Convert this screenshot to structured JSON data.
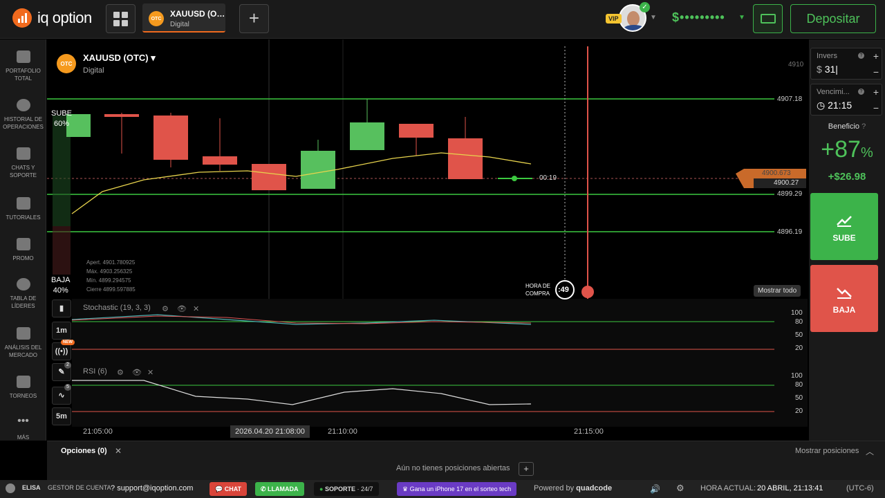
{
  "app": {
    "brand": "iq option"
  },
  "topbar": {
    "asset_tab_name": "XAUUSD (O…",
    "asset_tab_type": "Digital",
    "otc_badge": "OTC",
    "vip_badge": "VIP",
    "balance": "$•••••••••",
    "deposit_label": "Depositar"
  },
  "sidebar": {
    "items": [
      {
        "label": "PORTAFOLIO TOTAL",
        "icon": "briefcase-icon"
      },
      {
        "label": "HISTORIAL DE OPERACIONES",
        "icon": "clock-icon"
      },
      {
        "label": "CHATS Y SOPORTE",
        "icon": "chat-icon"
      },
      {
        "label": "TUTORIALES",
        "icon": "graduation-cap-icon"
      },
      {
        "label": "PROMO",
        "icon": "megaphone-icon"
      },
      {
        "label": "TABLA DE LÍDERES",
        "icon": "medal-icon"
      },
      {
        "label": "ANÁLISIS DEL MERCADO",
        "icon": "bar-chart-icon"
      },
      {
        "label": "TORNEOS",
        "icon": "trophy-icon"
      },
      {
        "label": "MÁS",
        "icon": "more-dots-icon"
      }
    ]
  },
  "chart_header": {
    "asset": "XAUUSD (OTC)",
    "type": "Digital",
    "sube_label": "SUBE",
    "sube_pct": "60%",
    "baja_label": "BAJA",
    "baja_pct": "40%",
    "stats": [
      "Apert.  4901.780925",
      "Máx.   4903.256325",
      "Mín.    4899.294575",
      "Cierre  4899.597885"
    ],
    "countdown": "00:19",
    "buy_time_label_1": "HORA DE",
    "buy_time_label_2": "COMPRA",
    "buy_timer": ":49",
    "show_all": "Mostrar todo",
    "current_price": "4900.27",
    "price_marker": "4900.673"
  },
  "price_levels": [
    "4910",
    "4907.18",
    "4899.29",
    "4896.19"
  ],
  "indicators": {
    "stochastic_label": "Stochastic (19, 3, 3)",
    "stoch_ticks": [
      "100",
      "80",
      "50",
      "20"
    ],
    "rsi_label": "RSI (6)",
    "rsi_ticks": [
      "100",
      "80",
      "50",
      "20"
    ]
  },
  "toolbar_mini": {
    "timeframe_1": "1m",
    "timeframe_2": "5m",
    "new_badge": "NEW",
    "draw_count": "2",
    "ind_count": "5"
  },
  "time_axis": [
    "21:05:00",
    "2026.04.20 21:08:00",
    "21:10:00",
    "21:15:00"
  ],
  "trade_panel": {
    "amount_label": "Invers",
    "currency": "$",
    "amount_value": "31",
    "expiry_label": "Vencimi...",
    "expiry_value": "21:15",
    "profit_label": "Beneficio",
    "profit_pct": "+87",
    "profit_pct_sign": "%",
    "profit_amount": "+$26.98",
    "up_label": "SUBE",
    "down_label": "BAJA"
  },
  "positions": {
    "tab_label": "Opciones (0)",
    "show_positions": "Mostrar posiciones",
    "empty_text": "Aún no tienes posiciones abiertas"
  },
  "statusbar": {
    "user": "ELISA",
    "account_manager": "GESTOR DE CUENTA",
    "support_email": "support@iqoption.com",
    "chat": "CHAT",
    "call": "LLAMADA",
    "support": "SOPORTE",
    "support_hours": "· 24/7",
    "promo": "Gana un iPhone 17 en el sorteo tech",
    "powered_by": "Powered by",
    "powered_brand": "quadcode",
    "time_label": "HORA ACTUAL:",
    "time_value": "20 ABRIL, 21:13:41",
    "tz": "(UTC-6)"
  },
  "colors": {
    "green": "#3cb34a",
    "red": "#e0544a",
    "orange": "#f06a1e",
    "bg": "#000000"
  }
}
